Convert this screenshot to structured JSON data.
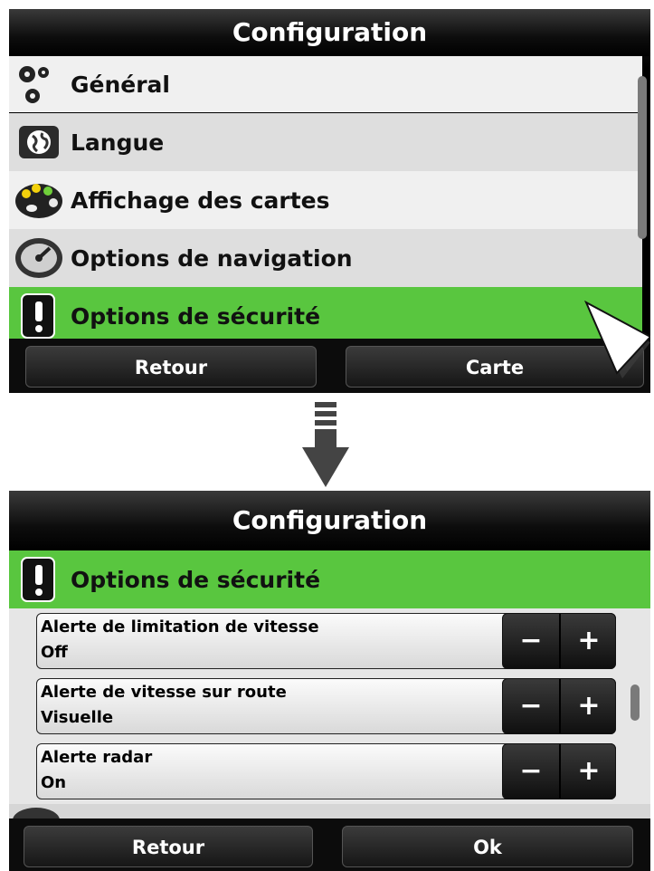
{
  "screen1": {
    "title": "Configuration",
    "menu": [
      {
        "label": "Général",
        "icon": "gears-icon"
      },
      {
        "label": "Langue",
        "icon": "globe-icon"
      },
      {
        "label": "Affichage des cartes",
        "icon": "palette-icon"
      },
      {
        "label": "Options de navigation",
        "icon": "speedometer-icon"
      },
      {
        "label": "Options de sécurité",
        "icon": "warning-icon",
        "selected": true
      }
    ],
    "back_label": "Retour",
    "map_label": "Carte"
  },
  "screen2": {
    "title": "Configuration",
    "section_title": "Options de sécurité",
    "settings": [
      {
        "label": "Alerte de limitation de vitesse",
        "value": "Off"
      },
      {
        "label": "Alerte de vitesse sur route",
        "value": "Visuelle"
      },
      {
        "label": "Alerte radar",
        "value": "On"
      }
    ],
    "minus_label": "−",
    "plus_label": "+",
    "back_label": "Retour",
    "ok_label": "Ok"
  },
  "colors": {
    "selected_row": "#59c63f",
    "titlebar": "#000000"
  }
}
